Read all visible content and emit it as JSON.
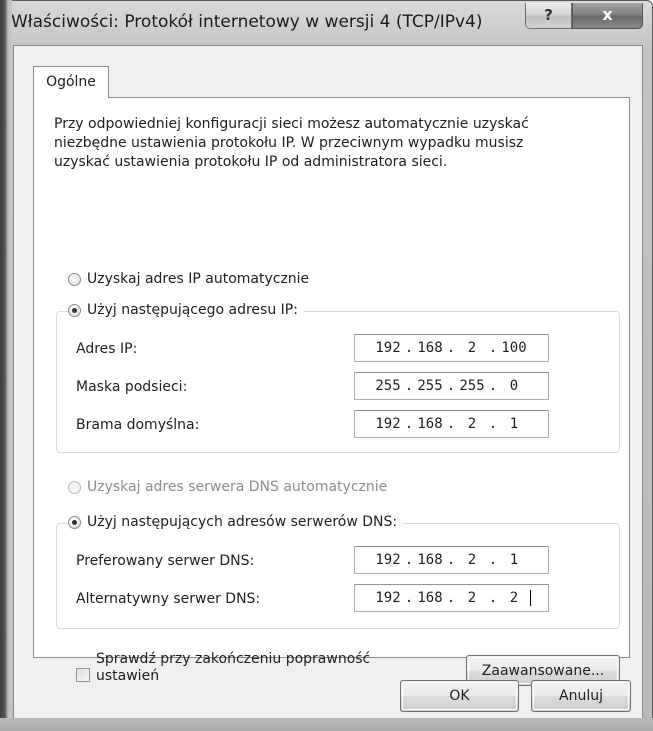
{
  "window": {
    "title": "Właściwości: Protokół internetowy w wersji 4 (TCP/IPv4)",
    "help_glyph": "?",
    "close_glyph": "x"
  },
  "tabs": [
    {
      "label": "Ogólne",
      "selected": true
    }
  ],
  "intro": {
    "lines": [
      "Przy odpowiedniej konfiguracji sieci możesz automatycznie uzyskać",
      "niezbędne ustawienia protokołu IP. W przeciwnym wypadku musisz",
      "uzyskać ustawienia protokołu IP od administratora sieci."
    ]
  },
  "ip_section": {
    "auto_label": "Uzyskaj adres IP automatycznie",
    "manual_label": "Użyj następującego adresu IP:",
    "selected": "manual",
    "fields": [
      {
        "label": "Adres IP:",
        "octets": [
          "192",
          "168",
          "2",
          "100"
        ]
      },
      {
        "label": "Maska podsieci:",
        "octets": [
          "255",
          "255",
          "255",
          "0"
        ]
      },
      {
        "label": "Brama domyślna:",
        "octets": [
          "192",
          "168",
          "2",
          "1"
        ]
      }
    ]
  },
  "dns_section": {
    "auto_label": "Uzyskaj adres serwera DNS automatycznie",
    "auto_disabled": true,
    "manual_label": "Użyj następujących adresów serwerów DNS:",
    "selected": "manual",
    "fields": [
      {
        "label": "Preferowany serwer DNS:",
        "octets": [
          "192",
          "168",
          "2",
          "1"
        ]
      },
      {
        "label": "Alternatywny serwer DNS:",
        "octets": [
          "192",
          "168",
          "2",
          "2"
        ],
        "focused": true
      }
    ]
  },
  "validate": {
    "label_line1": "Sprawdź przy zakończeniu poprawność",
    "label_line2": "ustawień",
    "checked": false
  },
  "buttons": {
    "advanced": "Zaawansowane...",
    "ok": "OK",
    "cancel": "Anuluj"
  },
  "colors": {
    "group_border": "#d5dfe5",
    "disabled_text": "#8d8d8d"
  }
}
